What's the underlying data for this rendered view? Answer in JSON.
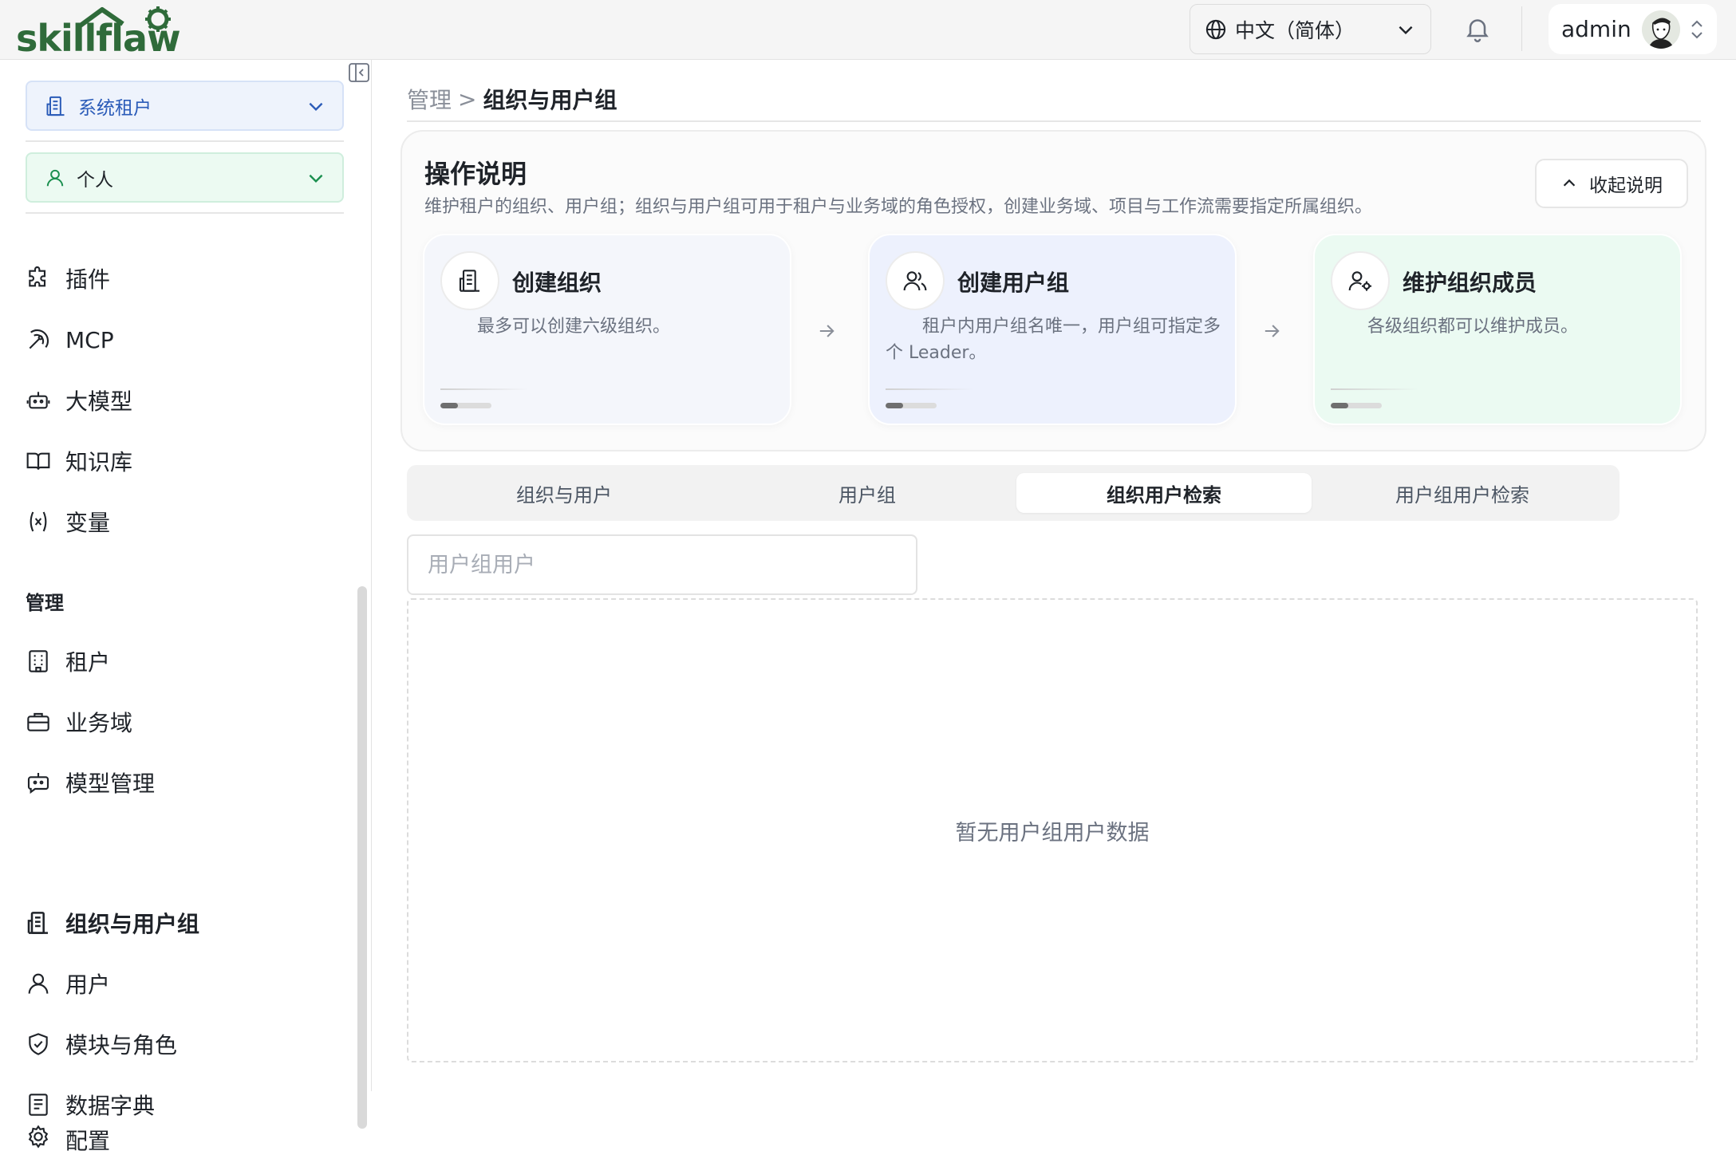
{
  "app": {
    "brand": "skillflaw",
    "brand_color": "#2f6b3a"
  },
  "topbar": {
    "language": "中文（简体）",
    "user_name": "admin"
  },
  "sidebar": {
    "tenant_select": "系统租户",
    "personal_select": "个人",
    "items": [
      {
        "label": "插件",
        "icon": "puzzle-icon"
      },
      {
        "label": "MCP",
        "icon": "mcp-icon"
      },
      {
        "label": "大模型",
        "icon": "robot-icon"
      },
      {
        "label": "知识库",
        "icon": "book-icon"
      },
      {
        "label": "变量",
        "icon": "variable-icon"
      }
    ],
    "section_title": "管理",
    "admin_items": [
      {
        "label": "租户",
        "icon": "building-icon"
      },
      {
        "label": "业务域",
        "icon": "briefcase-icon"
      },
      {
        "label": "模型管理",
        "icon": "bot-icon"
      },
      {
        "label": "组织与用户组",
        "icon": "org-icon",
        "active": true
      },
      {
        "label": "用户",
        "icon": "user-icon"
      },
      {
        "label": "模块与角色",
        "icon": "shield-icon"
      },
      {
        "label": "数据字典",
        "icon": "dictionary-icon"
      },
      {
        "label": "配置",
        "icon": "gear-icon"
      }
    ]
  },
  "breadcrumb": {
    "parent": "管理",
    "separator": ">",
    "current": "组织与用户组"
  },
  "guide": {
    "title": "操作说明",
    "description": "维护租户的组织、用户组；组织与用户组可用于租户与业务域的角色授权，创建业务域、项目与工作流需要指定所属组织。",
    "collapse_label": "收起说明",
    "steps": [
      {
        "title": "创建组织",
        "text": "最多可以创建六级组织。",
        "progress": 0.35,
        "color": "#f4f6fb"
      },
      {
        "title": "创建用户组",
        "text": "租户内用户组名唯一，用户组可指定多个 Leader。",
        "progress": 0.35,
        "color": "#edf1fd"
      },
      {
        "title": "维护组织成员",
        "text": "各级组织都可以维护成员。",
        "progress": 0.35,
        "color": "#ebfaf2"
      }
    ]
  },
  "tabs": [
    "组织与用户",
    "用户组",
    "组织用户检索",
    "用户组用户检索"
  ],
  "active_tab": 2,
  "search": {
    "placeholder": "用户组用户",
    "value": ""
  },
  "empty_state": "暂无用户组用户数据"
}
